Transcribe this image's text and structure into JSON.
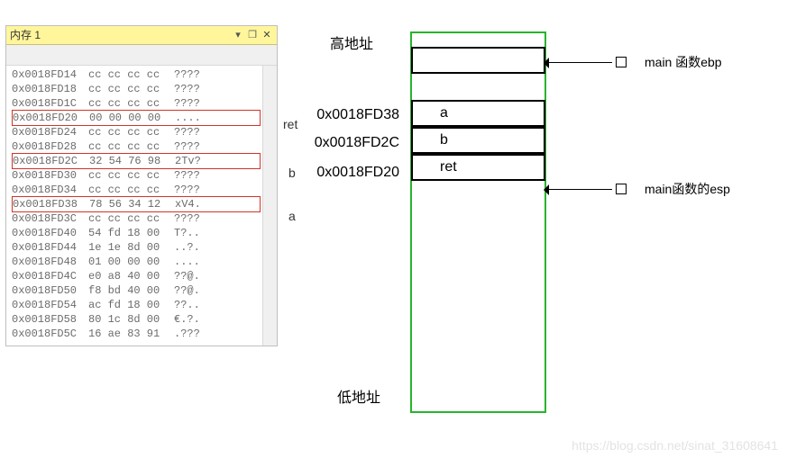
{
  "memory_window": {
    "title": "内存 1",
    "icons": {
      "down": "▾",
      "pin": "❒",
      "close": "✕"
    },
    "rows": [
      {
        "addr": "0x0018FD14",
        "bytes": "cc cc cc cc",
        "ascii": "????",
        "boxed": false
      },
      {
        "addr": "0x0018FD18",
        "bytes": "cc cc cc cc",
        "ascii": "????",
        "boxed": false
      },
      {
        "addr": "0x0018FD1C",
        "bytes": "cc cc cc cc",
        "ascii": "????",
        "boxed": false
      },
      {
        "addr": "0x0018FD20",
        "bytes": "00 00 00 00",
        "ascii": "....",
        "boxed": true
      },
      {
        "addr": "0x0018FD24",
        "bytes": "cc cc cc cc",
        "ascii": "????",
        "boxed": false
      },
      {
        "addr": "0x0018FD28",
        "bytes": "cc cc cc cc",
        "ascii": "????",
        "boxed": false
      },
      {
        "addr": "0x0018FD2C",
        "bytes": "32 54 76 98",
        "ascii": "2Tv?",
        "boxed": true
      },
      {
        "addr": "0x0018FD30",
        "bytes": "cc cc cc cc",
        "ascii": "????",
        "boxed": false
      },
      {
        "addr": "0x0018FD34",
        "bytes": "cc cc cc cc",
        "ascii": "????",
        "boxed": false
      },
      {
        "addr": "0x0018FD38",
        "bytes": "78 56 34 12",
        "ascii": "xV4.",
        "boxed": true
      },
      {
        "addr": "0x0018FD3C",
        "bytes": "cc cc cc cc",
        "ascii": "????",
        "boxed": false
      },
      {
        "addr": "0x0018FD40",
        "bytes": "54 fd 18 00",
        "ascii": "T?..",
        "boxed": false
      },
      {
        "addr": "0x0018FD44",
        "bytes": "1e 1e 8d 00",
        "ascii": "..?.",
        "boxed": false
      },
      {
        "addr": "0x0018FD48",
        "bytes": "01 00 00 00",
        "ascii": "....",
        "boxed": false
      },
      {
        "addr": "0x0018FD4C",
        "bytes": "e0 a8 40 00",
        "ascii": "??@.",
        "boxed": false
      },
      {
        "addr": "0x0018FD50",
        "bytes": "f8 bd 40 00",
        "ascii": "??@.",
        "boxed": false
      },
      {
        "addr": "0x0018FD54",
        "bytes": "ac fd 18 00",
        "ascii": "??..",
        "boxed": false
      },
      {
        "addr": "0x0018FD58",
        "bytes": "80 1c 8d 00",
        "ascii": "€.?.",
        "boxed": false
      },
      {
        "addr": "0x0018FD5C",
        "bytes": "16 ae 83 91",
        "ascii": ".???",
        "boxed": false
      }
    ]
  },
  "row_labels": {
    "ret": "ret",
    "b": "b",
    "a": "a"
  },
  "headers": {
    "high": "高地址",
    "low": "低地址"
  },
  "stack_cells": {
    "empty_top": "",
    "a": "a",
    "b": "b",
    "ret": "ret"
  },
  "stack_addrs": {
    "a": "0x0018FD38",
    "b": "0x0018FD2C",
    "ret": "0x0018FD20"
  },
  "pointers": {
    "ebp": "main 函数ebp",
    "esp": "main函数的esp"
  },
  "watermark": "https://blog.csdn.net/sinat_31608641"
}
